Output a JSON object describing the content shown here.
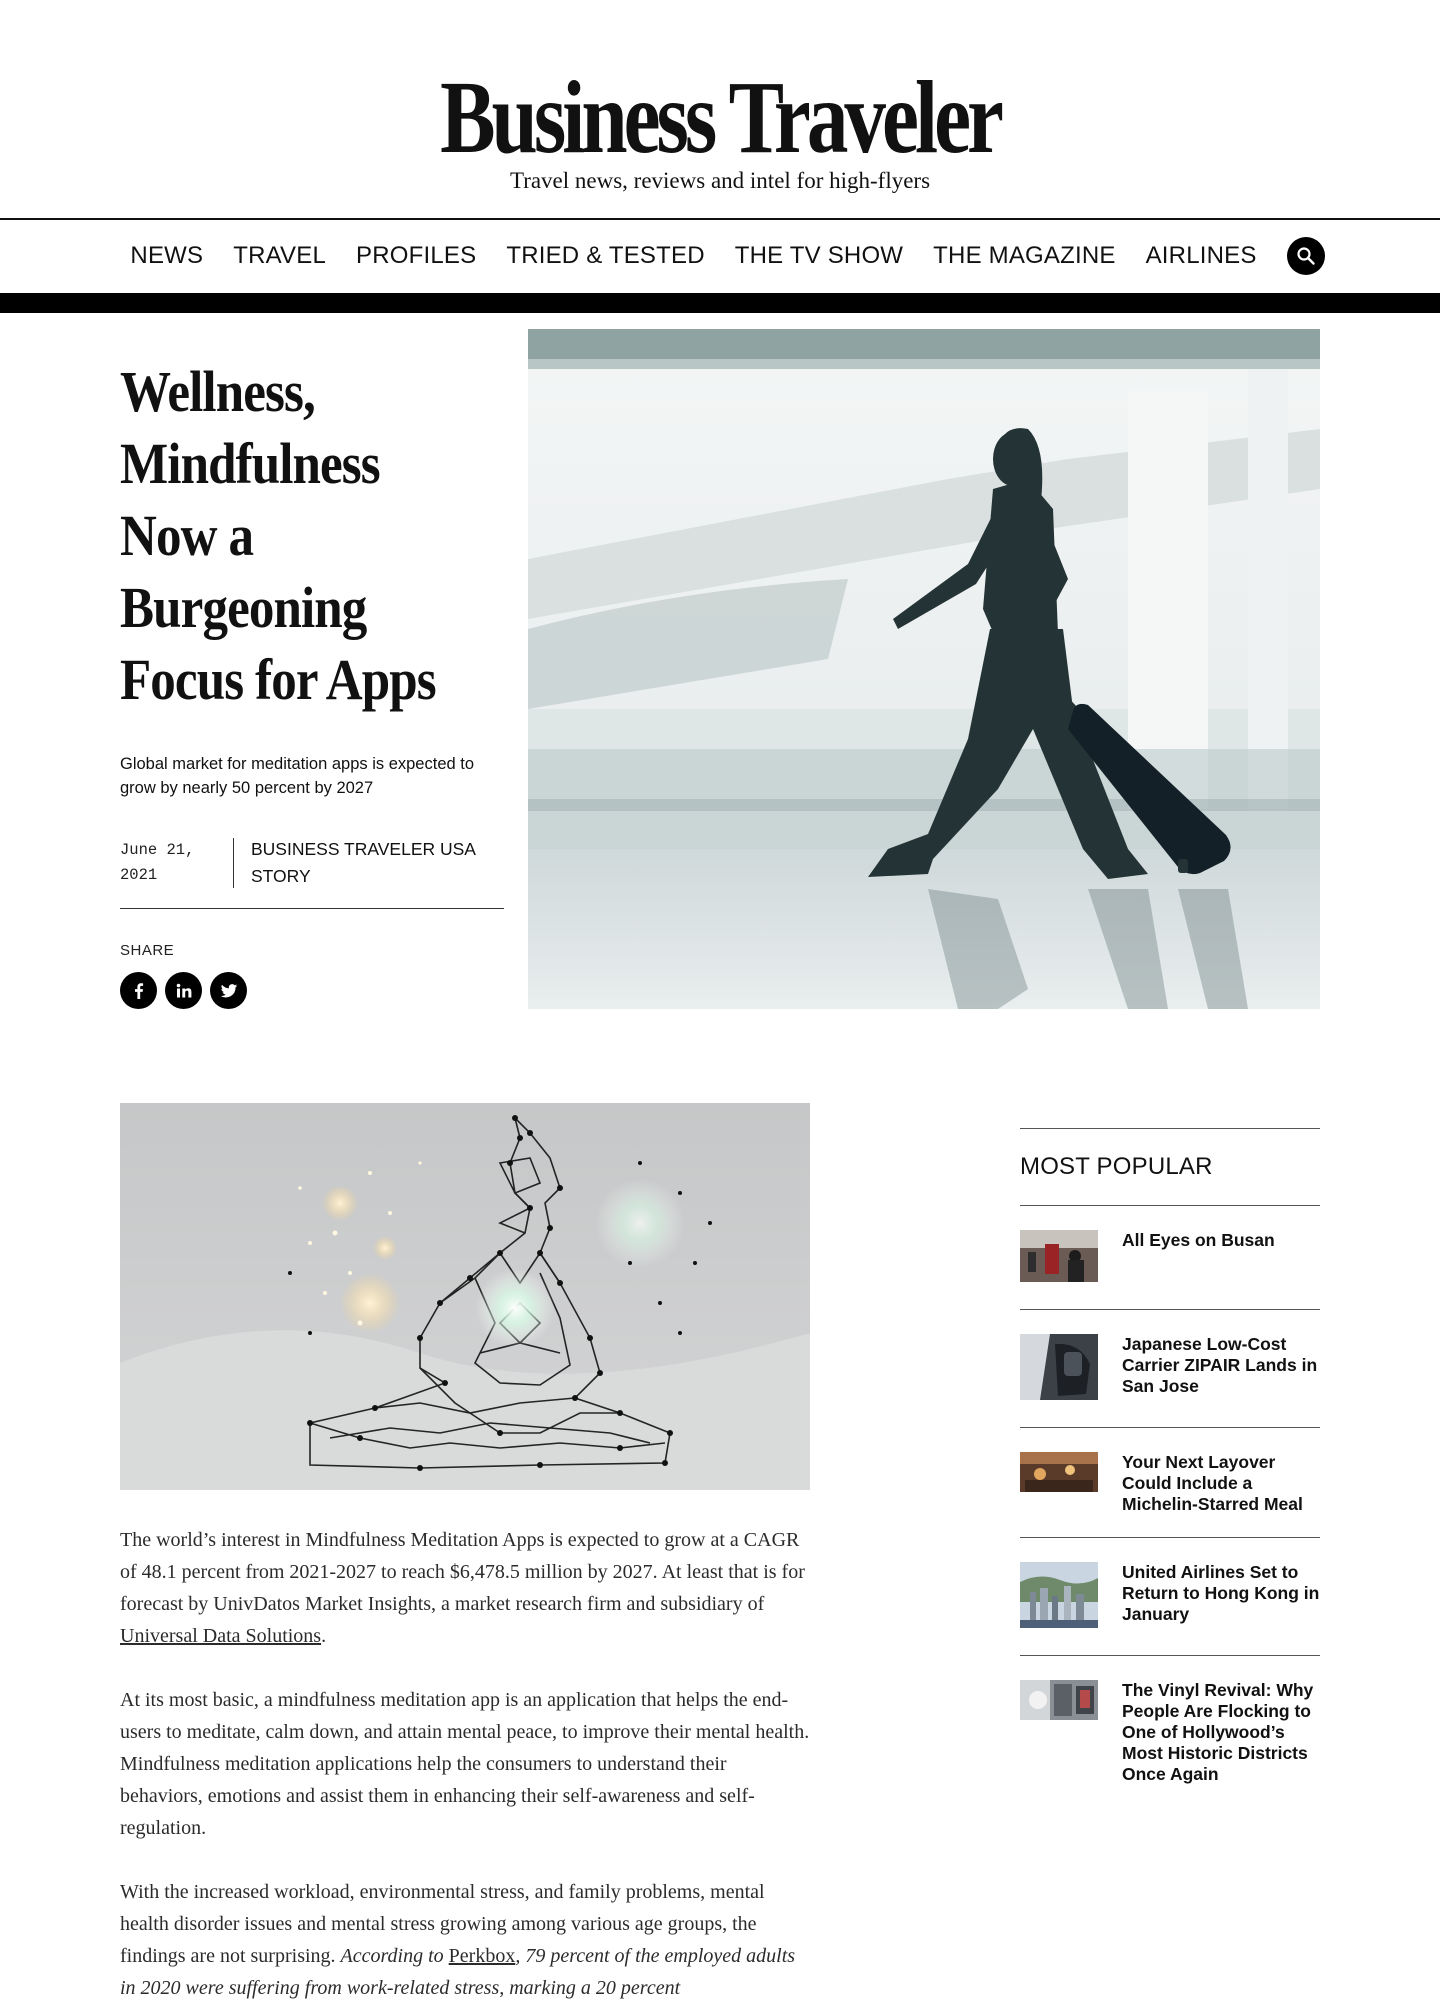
{
  "site": {
    "logo": "Business Traveler",
    "tagline": "Travel news, reviews and intel for high-flyers"
  },
  "nav": {
    "items": [
      "NEWS",
      "TRAVEL",
      "PROFILES",
      "TRIED & TESTED",
      "THE TV SHOW",
      "THE MAGAZINE",
      "AIRLINES"
    ],
    "search_icon": "search-icon"
  },
  "article": {
    "title_lines": [
      "Wellness,",
      "Mindfulness",
      "Now a",
      "Burgeoning",
      "Focus for Apps"
    ],
    "dek": "Global market for meditation apps is expected to grow by nearly 50 percent by 2027",
    "date": "June 21, 2021",
    "source": "BUSINESS TRAVELER USA STORY",
    "share_label": "SHARE",
    "share_icons": [
      "facebook-icon",
      "linkedin-icon",
      "twitter-icon"
    ],
    "p1_a": "The world’s interest in Mindfulness Meditation Apps is expected to grow at a CAGR of 48.1 percent from 2021-2027 to reach $6,478.5 million by 2027. At least that is for forecast by UnivDatos Market Insights, a market research firm and subsidiary of ",
    "p1_link": "Universal Data Solutions",
    "p1_b": ".",
    "p2": "At its most basic, a mindfulness meditation app is an application that helps the end-users to meditate, calm down, and attain mental peace, to improve their mental health. Mindfulness meditation applications help the consumers to understand their behaviors, emotions and assist them in enhancing their self-awareness and self-regulation.",
    "p3_a": "With the increased workload, environmental stress, and family problems, mental health disorder issues and mental stress growing among various age groups, the findings are not surprising. ",
    "p3_em_a": "According to ",
    "p3_link": "Perkbox",
    "p3_em_b": ", 79 percent of the employed adults in 2020 were suffering from work-related stress, marking a 20 percent"
  },
  "sidebar": {
    "heading": "MOST POPULAR",
    "items": [
      {
        "title": "All Eyes on Busan"
      },
      {
        "title": "Japanese Low-Cost Carrier ZIPAIR Lands in San Jose"
      },
      {
        "title": "Your Next Layover Could Include a Michelin-Starred Meal"
      },
      {
        "title": "United Airlines Set to Return to Hong Kong in January"
      },
      {
        "title": "The Vinyl Revival: Why People Are Flocking to One of Hollywood’s Most Historic Districts Once Again"
      }
    ]
  }
}
